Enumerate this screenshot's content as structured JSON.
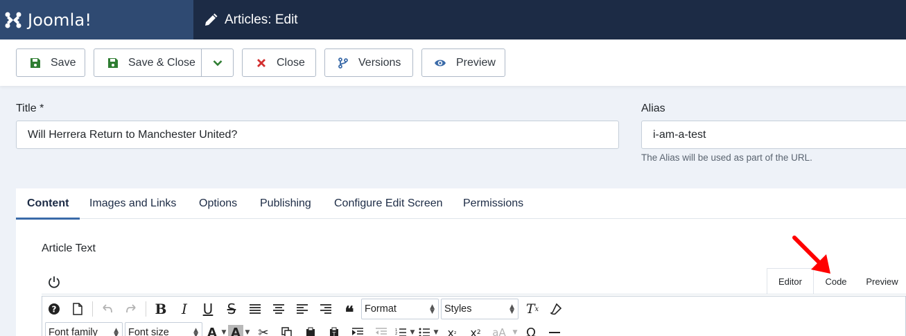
{
  "header": {
    "brand": "Joomla!",
    "page_title": "Articles: Edit"
  },
  "toolbar": {
    "save": "Save",
    "save_close": "Save & Close",
    "close": "Close",
    "versions": "Versions",
    "preview": "Preview"
  },
  "form": {
    "title_label": "Title *",
    "title_value": "Will Herrera Return to Manchester United?",
    "alias_label": "Alias",
    "alias_value": "i-am-a-test",
    "alias_hint": "The Alias will be used as part of the URL."
  },
  "tabs": [
    "Content",
    "Images and Links",
    "Options",
    "Publishing",
    "Configure Edit Screen",
    "Permissions"
  ],
  "content": {
    "article_text_label": "Article Text",
    "editor_tabs": [
      "Editor",
      "Code",
      "Preview"
    ],
    "format_select": "Format",
    "styles_select": "Styles",
    "font_family_select": "Font family",
    "font_size_select": "Font size"
  },
  "colors": {
    "header_bg": "#1c2b45",
    "brand_bg": "#2f4a72",
    "save_icon": "#2f7d32",
    "close_icon": "#d32f2f",
    "versions_icon": "#3a6aa8",
    "preview_icon": "#3a6aa8",
    "annotation_arrow": "#ff0000"
  }
}
